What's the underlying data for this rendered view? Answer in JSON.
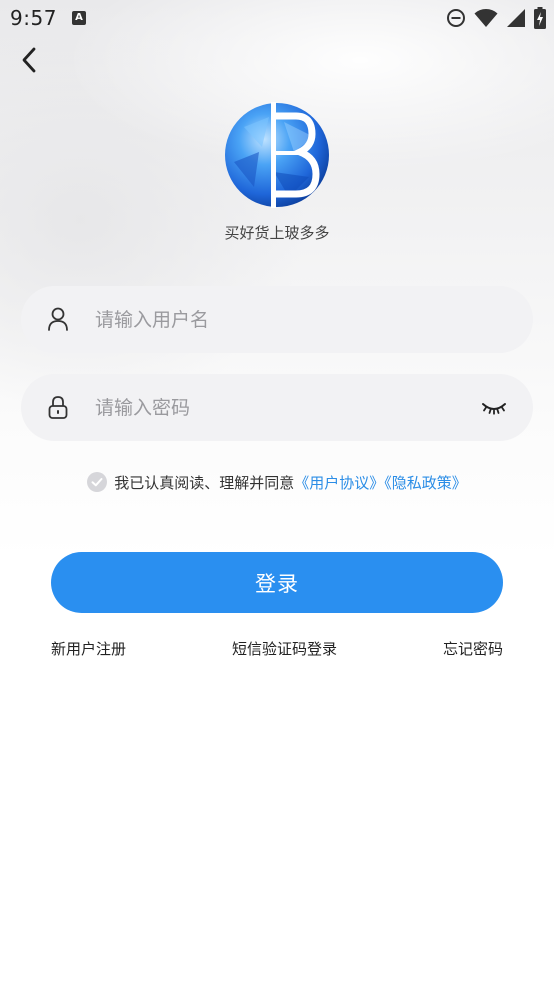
{
  "status_bar": {
    "time": "9:57",
    "notification_icon_letter": "A",
    "icons": [
      "do-not-disturb-icon",
      "wifi-icon",
      "cellular-signal-icon",
      "battery-charging-icon"
    ]
  },
  "header": {
    "back_icon": "chevron-left-icon"
  },
  "brand": {
    "slogan": "买好货上玻多多",
    "logo_colors": [
      "#1f66d9",
      "#4aa3f5",
      "#0c3f9e"
    ]
  },
  "form": {
    "username": {
      "placeholder": "请输入用户名",
      "value": "",
      "icon": "user-icon"
    },
    "password": {
      "placeholder": "请输入密码",
      "value": "",
      "icon": "lock-icon",
      "toggle_icon": "eye-closed-icon"
    }
  },
  "agreement": {
    "checked": true,
    "text": "我已认真阅读、理解并同意",
    "user_agreement": "《用户协议》",
    "privacy_policy": "《隐私政策》"
  },
  "actions": {
    "login_label": "登录",
    "register_label": "新用户注册",
    "sms_login_label": "短信验证码登录",
    "forgot_password_label": "忘记密码"
  },
  "colors": {
    "accent": "#2a8ff0",
    "link": "#2b8de6",
    "field_bg": "#f2f2f4",
    "placeholder": "#9a9a9e"
  }
}
